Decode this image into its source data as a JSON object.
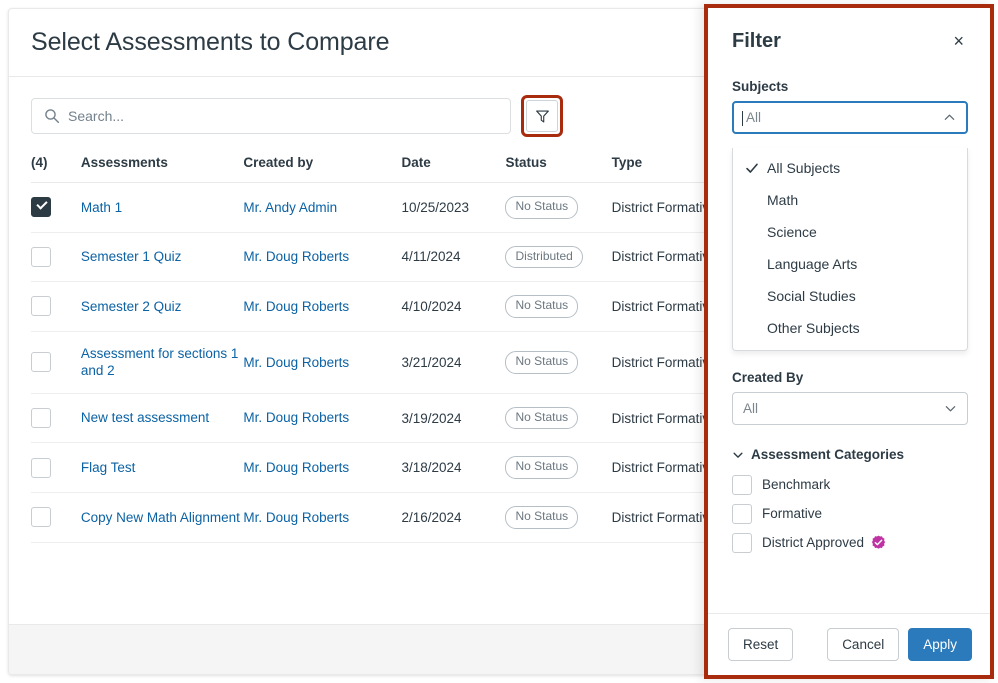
{
  "dialog": {
    "title": "Select Assessments to Compare",
    "search": {
      "placeholder": "Search...",
      "value": "",
      "icon": "search-icon"
    },
    "filter_button": {
      "icon": "funnel-icon",
      "highlight_color": "#a82b0e"
    },
    "table": {
      "columns": [
        "(4)",
        "Assessments",
        "Created by",
        "Date",
        "Status",
        "Type",
        ""
      ],
      "rows": [
        {
          "checked": true,
          "name": "Math 1",
          "created_by": "Mr. Andy Admin",
          "date": "10/25/2023",
          "status": "No Status",
          "type": "District Formative"
        },
        {
          "checked": false,
          "name": "Semester 1 Quiz",
          "created_by": "Mr. Doug Roberts",
          "date": "4/11/2024",
          "status": "Distributed",
          "type": "District Formative"
        },
        {
          "checked": false,
          "name": "Semester 2 Quiz",
          "created_by": "Mr. Doug Roberts",
          "date": "4/10/2024",
          "status": "No Status",
          "type": "District Formative"
        },
        {
          "checked": false,
          "name": "Assessment for sections 1 and 2",
          "created_by": "Mr. Doug Roberts",
          "date": "3/21/2024",
          "status": "No Status",
          "type": "District Formative"
        },
        {
          "checked": false,
          "name": "New test assessment",
          "created_by": "Mr. Doug Roberts",
          "date": "3/19/2024",
          "status": "No Status",
          "type": "District Formative"
        },
        {
          "checked": false,
          "name": "Flag Test",
          "created_by": "Mr. Doug Roberts",
          "date": "3/18/2024",
          "status": "No Status",
          "type": "District Formative"
        },
        {
          "checked": false,
          "name": "Copy New Math Alignment",
          "created_by": "Mr. Doug Roberts",
          "date": "2/16/2024",
          "status": "No Status",
          "type": "District Formative"
        }
      ]
    }
  },
  "filter_panel": {
    "title": "Filter",
    "close_label": "×",
    "subjects": {
      "label": "Subjects",
      "value": "All",
      "placeholder": "All",
      "expanded": true,
      "options": [
        {
          "label": "All Subjects",
          "selected": true
        },
        {
          "label": "Math",
          "selected": false
        },
        {
          "label": "Science",
          "selected": false
        },
        {
          "label": "Language Arts",
          "selected": false
        },
        {
          "label": "Social Studies",
          "selected": false
        },
        {
          "label": "Other Subjects",
          "selected": false
        }
      ]
    },
    "created_by": {
      "label": "Created By",
      "value": "All"
    },
    "categories": {
      "label": "Assessment Categories",
      "expanded": true,
      "items": [
        {
          "label": "Benchmark",
          "checked": false,
          "badge": false
        },
        {
          "label": "Formative",
          "checked": false,
          "badge": false
        },
        {
          "label": "District Approved",
          "checked": false,
          "badge": true,
          "badge_color": "#bf32a4"
        }
      ]
    },
    "footer": {
      "reset": "Reset",
      "cancel": "Cancel",
      "apply": "Apply",
      "apply_color": "#2b7abc"
    }
  }
}
